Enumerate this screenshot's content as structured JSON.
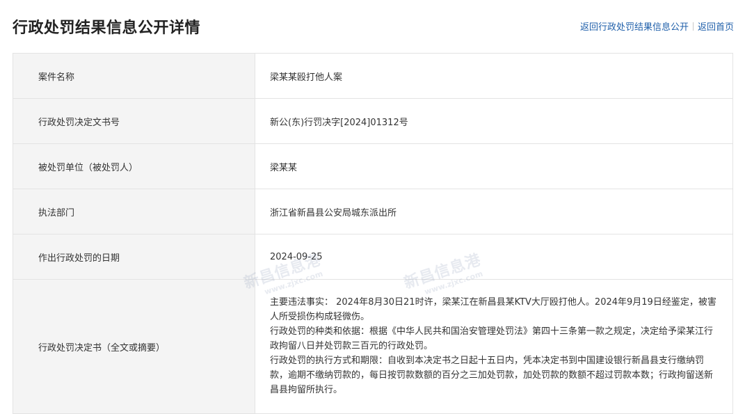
{
  "header": {
    "title": "行政处罚结果信息公开详情",
    "links": {
      "back_list": "返回行政处罚结果信息公开",
      "back_home": "返回首页"
    }
  },
  "rows": [
    {
      "label": "案件名称",
      "value": "梁某某殴打他人案"
    },
    {
      "label": "行政处罚决定文书号",
      "value": "新公(东)行罚决字[2024]01312号"
    },
    {
      "label": "被处罚单位（被处罚人）",
      "value": "梁某某"
    },
    {
      "label": "执法部门",
      "value": "浙江省新昌县公安局城东派出所"
    },
    {
      "label": "作出行政处罚的日期",
      "value": "2024-09-25"
    }
  ],
  "decision": {
    "label": "行政处罚决定书（全文或摘要）",
    "paragraphs": [
      "主要违法事实： 2024年8月30日21时许，梁某江在新昌县某KTV大厅殴打他人。2024年9月19日经鉴定，被害人所受损伤构成轻微伤。",
      "行政处罚的种类和依据：根据《中华人民共和国治安管理处罚法》第四十三条第一款之规定，决定给予梁某江行政拘留八日并处罚款三百元的行政处罚。",
      "行政处罚的执行方式和期限：自收到本决定书之日起十五日内，凭本决定书到中国建设银行新昌县支行缴纳罚款，逾期不缴纳罚款的，每日按罚款数额的百分之三加处罚款，加处罚款的数额不超过罚款本数；行政拘留送新昌县拘留所执行。"
    ]
  },
  "watermark": {
    "text": "新昌信息港",
    "url": "www.zjxc.com"
  }
}
